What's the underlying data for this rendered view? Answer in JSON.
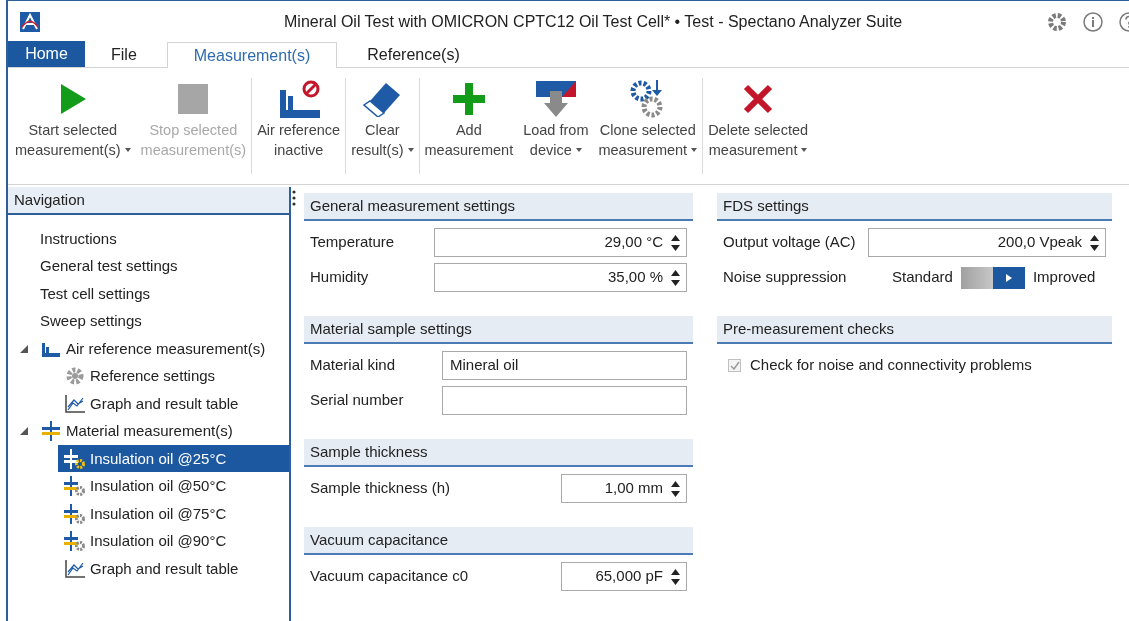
{
  "window": {
    "title": "Mineral Oil Test with OMICRON CPTC12 Oil Test Cell* • Test - Spectano Analyzer Suite"
  },
  "tabs": [
    {
      "label": "Home",
      "kind": "app",
      "selected": false
    },
    {
      "label": "File",
      "kind": "tab",
      "selected": false
    },
    {
      "label": "Measurement(s)",
      "kind": "tab",
      "selected": true
    },
    {
      "label": "Reference(s)",
      "kind": "tab",
      "selected": false
    }
  ],
  "ribbon_groups": [
    {
      "buttons": [
        {
          "kind": "play",
          "lines": [
            "Start selected",
            "measurement(s)"
          ],
          "dropdown": true,
          "disabled": false
        },
        {
          "kind": "stop",
          "lines": [
            "Stop selected",
            "measurement(s)"
          ],
          "dropdown": false,
          "disabled": true
        }
      ]
    },
    {
      "buttons": [
        {
          "kind": "air",
          "lines": [
            "Air reference",
            "inactive"
          ],
          "dropdown": false,
          "disabled": false
        }
      ]
    },
    {
      "buttons": [
        {
          "kind": "eraser",
          "lines": [
            "Clear",
            "result(s)"
          ],
          "dropdown": true,
          "disabled": false
        }
      ]
    },
    {
      "buttons": [
        {
          "kind": "add",
          "lines": [
            "Add",
            "measurement"
          ],
          "dropdown": false,
          "disabled": false
        },
        {
          "kind": "load",
          "lines": [
            "Load from",
            "device"
          ],
          "dropdown": true,
          "disabled": false
        },
        {
          "kind": "clone",
          "lines": [
            "Clone selected",
            "measurement"
          ],
          "dropdown": true,
          "disabled": false
        }
      ]
    },
    {
      "buttons": [
        {
          "kind": "delete",
          "lines": [
            "Delete selected",
            "measurement"
          ],
          "dropdown": true,
          "disabled": false
        }
      ]
    }
  ],
  "navigation": {
    "title": "Navigation",
    "items": [
      {
        "label": "Instructions",
        "kind": "plain",
        "selected": false
      },
      {
        "label": "General test settings",
        "kind": "plain",
        "selected": false
      },
      {
        "label": "Test cell settings",
        "kind": "plain",
        "selected": false
      },
      {
        "label": "Sweep settings",
        "kind": "plain",
        "selected": false
      },
      {
        "label": "Air reference measurement(s)",
        "kind": "air",
        "selected": false,
        "expanded": true,
        "children": [
          {
            "label": "Reference settings",
            "kind": "gear",
            "selected": false
          },
          {
            "label": "Graph and result table",
            "kind": "graph",
            "selected": false
          }
        ]
      },
      {
        "label": "Material measurement(s)",
        "kind": "material",
        "selected": false,
        "expanded": true,
        "children": [
          {
            "label": "Insulation oil @25°C",
            "kind": "sample",
            "selected": true
          },
          {
            "label": "Insulation oil @50°C",
            "kind": "sample",
            "selected": false
          },
          {
            "label": "Insulation oil @75°C",
            "kind": "sample",
            "selected": false
          },
          {
            "label": "Insulation oil @90°C",
            "kind": "sample",
            "selected": false
          },
          {
            "label": "Graph and result table",
            "kind": "graph",
            "selected": false
          }
        ]
      }
    ]
  },
  "columns": [
    [
      {
        "title": "General measurement settings",
        "rows": [
          {
            "kind": "spinner",
            "label": "Temperature",
            "value": "29,00 °C",
            "wide": true
          },
          {
            "kind": "spinner",
            "label": "Humidity",
            "value": "35,00 %",
            "wide": true
          }
        ]
      },
      {
        "title": "Material sample settings",
        "rows": [
          {
            "kind": "text",
            "label": "Material kind",
            "value": "Mineral oil"
          },
          {
            "kind": "text",
            "label": "Serial number"
          }
        ]
      },
      {
        "title": "Sample thickness",
        "rows": [
          {
            "kind": "spinner",
            "label": "Sample thickness (h)",
            "value": "1,00 mm",
            "wide": false
          }
        ]
      },
      {
        "title": "Vacuum capacitance",
        "rows": [
          {
            "kind": "spinner",
            "label": "Vacuum capacitance c0",
            "value": "65,000 pF",
            "wide": false
          }
        ]
      }
    ],
    [
      {
        "title": "FDS settings",
        "rows": [
          {
            "kind": "spinner",
            "label": "Output voltage (AC)",
            "value": "200,0 Vpeak",
            "wide": true
          },
          {
            "kind": "toggle",
            "label": "Noise suppression",
            "off_label": "Standard",
            "on_label": "Improved",
            "on": true
          }
        ]
      },
      {
        "title": "Pre-measurement checks",
        "rows": [
          {
            "kind": "checkbox",
            "label": "Check for noise and connectivity problems",
            "checked": true,
            "disabled": true
          }
        ]
      }
    ]
  ]
}
